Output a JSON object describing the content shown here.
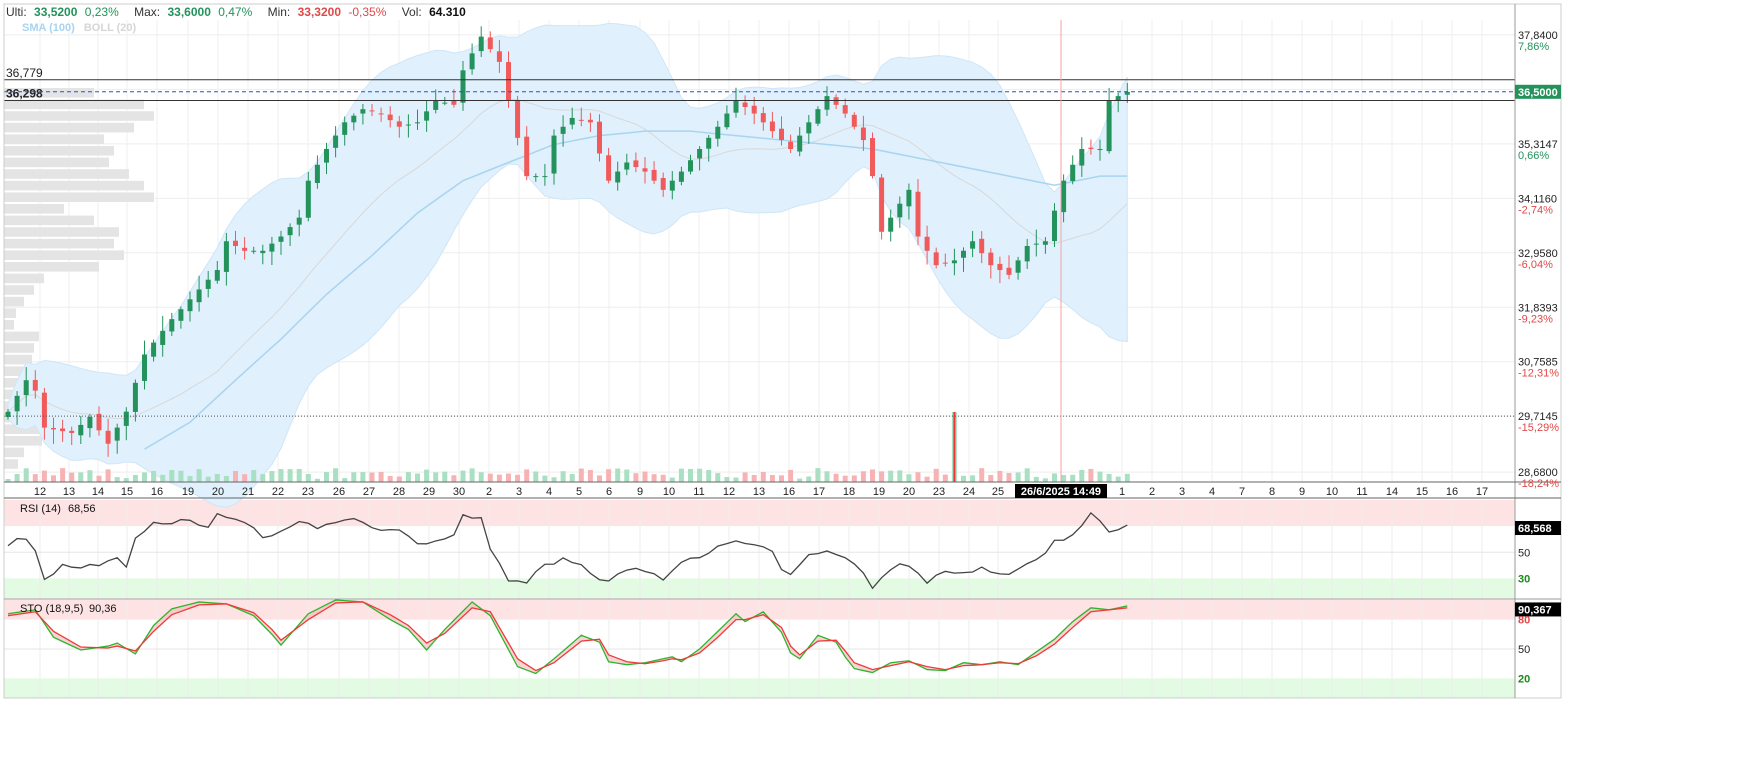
{
  "topbar": {
    "last_label": "Ulti:",
    "last_value": "33,5200",
    "last_pct": "0,23%",
    "max_label": "Max:",
    "max_value": "33,6000",
    "max_pct": "0,47%",
    "min_label": "Min:",
    "min_value": "33,3200",
    "min_pct": "-0,35%",
    "vol_label": "Vol:",
    "vol_value": "64.310"
  },
  "legend": {
    "sma": "SMA (100)",
    "boll": "BOLL (20)"
  },
  "colors": {
    "up": "#23925b",
    "down": "#f05a5a",
    "sma": "#a8d4f0",
    "band_fill": "#e0f0fc",
    "rsi": "#444444",
    "sto_k": "#2db52d",
    "sto_d": "#ee3a3a",
    "overbought": "#fde3e3",
    "oversold": "#e3fae3",
    "price_tag": "#23925b"
  },
  "chart_data": [
    {
      "type": "candlestick",
      "ticker_panel": "price",
      "y_ticks": [
        {
          "value": "37,8400",
          "pct": "7,86%"
        },
        {
          "value": "36,5555",
          "pct": ""
        },
        {
          "value": "35,3147",
          "pct": "0,66%"
        },
        {
          "value": "34,1160",
          "pct": "-2,74%"
        },
        {
          "value": "32,9580",
          "pct": "-6,04%"
        },
        {
          "value": "31,8393",
          "pct": "-9,23%"
        },
        {
          "value": "30,7585",
          "pct": "-12,31%"
        },
        {
          "value": "29,7145",
          "pct": "-15,29%"
        },
        {
          "value": "28,6800",
          "pct": "-18,24%"
        }
      ],
      "ylim": [
        28.5,
        38.2
      ],
      "scale": "log",
      "x_ticks": [
        "12",
        "13",
        "14",
        "15",
        "16",
        "19",
        "20",
        "21",
        "22",
        "23",
        "26",
        "27",
        "28",
        "29",
        "30",
        "2",
        "3",
        "4",
        "5",
        "6",
        "9",
        "10",
        "11",
        "12",
        "13",
        "16",
        "17",
        "18",
        "19",
        "20",
        "23",
        "24",
        "25",
        "1",
        "2",
        "3",
        "4",
        "7",
        "8",
        "9",
        "10",
        "11",
        "14",
        "15",
        "16",
        "17"
      ],
      "crosshair_label": "26/6/2025 14:49",
      "current_price_tag": "36,5000",
      "current_price": 36.5,
      "level_lines": [
        {
          "label": "36,779",
          "value": 36.779
        },
        {
          "label": "36,298",
          "value": 36.298
        }
      ],
      "reference_line": 29.7145,
      "anchors": [
        [
          0,
          29.8
        ],
        [
          2,
          30.4
        ],
        [
          3,
          30.2
        ],
        [
          4,
          29.5
        ],
        [
          7,
          29.4
        ],
        [
          9,
          29.7
        ],
        [
          11,
          29.2
        ],
        [
          13,
          29.8
        ],
        [
          15,
          30.9
        ],
        [
          18,
          31.6
        ],
        [
          21,
          32.2
        ],
        [
          23,
          32.6
        ],
        [
          24,
          33.2
        ],
        [
          26,
          33.0
        ],
        [
          28,
          33.0
        ],
        [
          30,
          33.3
        ],
        [
          32,
          33.7
        ],
        [
          33,
          34.5
        ],
        [
          35,
          35.2
        ],
        [
          37,
          35.8
        ],
        [
          39,
          36.1
        ],
        [
          41,
          36.0
        ],
        [
          43,
          35.7
        ],
        [
          45,
          35.8
        ],
        [
          47,
          36.3
        ],
        [
          49,
          36.2
        ],
        [
          50,
          37.0
        ],
        [
          52,
          37.8
        ],
        [
          54,
          37.2
        ],
        [
          55,
          36.3
        ],
        [
          57,
          34.6
        ],
        [
          59,
          34.6
        ],
        [
          60,
          35.5
        ],
        [
          62,
          35.9
        ],
        [
          64,
          35.8
        ],
        [
          65,
          35.1
        ],
        [
          66,
          34.5
        ],
        [
          68,
          34.9
        ],
        [
          70,
          34.7
        ],
        [
          72,
          34.3
        ],
        [
          74,
          34.7
        ],
        [
          76,
          35.2
        ],
        [
          78,
          35.7
        ],
        [
          80,
          36.3
        ],
        [
          82,
          36.0
        ],
        [
          84,
          35.6
        ],
        [
          86,
          35.2
        ],
        [
          88,
          35.8
        ],
        [
          90,
          36.4
        ],
        [
          92,
          36.0
        ],
        [
          94,
          35.4
        ],
        [
          95,
          34.6
        ],
        [
          96,
          33.4
        ],
        [
          98,
          34.0
        ],
        [
          99,
          34.3
        ],
        [
          100,
          33.3
        ],
        [
          102,
          32.7
        ],
        [
          104,
          32.8
        ],
        [
          106,
          33.2
        ],
        [
          108,
          32.7
        ],
        [
          110,
          32.5
        ],
        [
          112,
          33.1
        ],
        [
          114,
          33.2
        ],
        [
          116,
          34.5
        ],
        [
          118,
          35.2
        ],
        [
          120,
          35.2
        ],
        [
          121,
          36.3
        ],
        [
          123,
          36.5
        ]
      ],
      "sma_anchors": [
        [
          15,
          29.1
        ],
        [
          20,
          29.6
        ],
        [
          25,
          30.4
        ],
        [
          30,
          31.2
        ],
        [
          35,
          32.1
        ],
        [
          40,
          32.9
        ],
        [
          45,
          33.8
        ],
        [
          50,
          34.5
        ],
        [
          55,
          34.9
        ],
        [
          60,
          35.3
        ],
        [
          65,
          35.5
        ],
        [
          70,
          35.6
        ],
        [
          75,
          35.6
        ],
        [
          80,
          35.5
        ],
        [
          85,
          35.4
        ],
        [
          90,
          35.3
        ],
        [
          95,
          35.2
        ],
        [
          100,
          35.0
        ],
        [
          105,
          34.8
        ],
        [
          110,
          34.6
        ],
        [
          115,
          34.4
        ],
        [
          120,
          34.6
        ],
        [
          123,
          34.6
        ]
      ]
    },
    {
      "type": "line",
      "ticker_panel": "rsi",
      "label": "RSI (14)",
      "last_label": "68,56",
      "tag": "68,568",
      "levels": [
        "50",
        "30"
      ],
      "ylim": [
        15,
        90
      ],
      "anchors": [
        [
          0,
          57
        ],
        [
          2,
          60
        ],
        [
          3,
          50
        ],
        [
          4,
          28
        ],
        [
          6,
          42
        ],
        [
          8,
          38
        ],
        [
          10,
          40
        ],
        [
          12,
          44
        ],
        [
          13,
          38
        ],
        [
          14,
          60
        ],
        [
          16,
          71
        ],
        [
          20,
          74
        ],
        [
          22,
          69
        ],
        [
          23,
          78
        ],
        [
          25,
          76
        ],
        [
          27,
          69
        ],
        [
          28,
          60
        ],
        [
          30,
          66
        ],
        [
          32,
          72
        ],
        [
          34,
          70
        ],
        [
          36,
          73
        ],
        [
          38,
          74
        ],
        [
          40,
          69
        ],
        [
          42,
          68
        ],
        [
          44,
          63
        ],
        [
          45,
          57
        ],
        [
          47,
          57
        ],
        [
          49,
          65
        ],
        [
          50,
          78
        ],
        [
          52,
          77
        ],
        [
          53,
          53
        ],
        [
          55,
          28
        ],
        [
          57,
          26
        ],
        [
          59,
          41
        ],
        [
          61,
          44
        ],
        [
          63,
          40
        ],
        [
          65,
          30
        ],
        [
          66,
          28
        ],
        [
          68,
          38
        ],
        [
          70,
          36
        ],
        [
          72,
          30
        ],
        [
          74,
          42
        ],
        [
          76,
          45
        ],
        [
          78,
          56
        ],
        [
          80,
          59
        ],
        [
          82,
          54
        ],
        [
          84,
          52
        ],
        [
          85,
          38
        ],
        [
          86,
          33
        ],
        [
          88,
          47
        ],
        [
          90,
          49
        ],
        [
          92,
          46
        ],
        [
          94,
          36
        ],
        [
          95,
          24
        ],
        [
          97,
          38
        ],
        [
          99,
          41
        ],
        [
          101,
          28
        ],
        [
          103,
          35
        ],
        [
          105,
          33
        ],
        [
          107,
          37
        ],
        [
          109,
          32
        ],
        [
          111,
          38
        ],
        [
          113,
          43
        ],
        [
          115,
          58
        ],
        [
          117,
          62
        ],
        [
          119,
          79
        ],
        [
          121,
          67
        ],
        [
          123,
          69
        ]
      ]
    },
    {
      "type": "line",
      "ticker_panel": "sto",
      "label": "STO (18,9,5)",
      "last_label": "90,36",
      "tag": "90,367",
      "levels": [
        "80",
        "50",
        "20"
      ],
      "ylim": [
        0,
        100
      ],
      "k_anchors": [
        [
          0,
          86
        ],
        [
          3,
          90
        ],
        [
          5,
          62
        ],
        [
          8,
          49
        ],
        [
          11,
          53
        ],
        [
          12,
          56
        ],
        [
          14,
          45
        ],
        [
          16,
          74
        ],
        [
          18,
          91
        ],
        [
          21,
          98
        ],
        [
          24,
          96
        ],
        [
          27,
          84
        ],
        [
          29,
          65
        ],
        [
          30,
          54
        ],
        [
          33,
          86
        ],
        [
          36,
          100
        ],
        [
          39,
          98
        ],
        [
          42,
          80
        ],
        [
          44,
          70
        ],
        [
          46,
          49
        ],
        [
          48,
          70
        ],
        [
          51,
          98
        ],
        [
          53,
          84
        ],
        [
          56,
          32
        ],
        [
          58,
          25
        ],
        [
          60,
          40
        ],
        [
          63,
          64
        ],
        [
          65,
          57
        ],
        [
          66,
          37
        ],
        [
          68,
          34
        ],
        [
          70,
          36
        ],
        [
          72,
          40
        ],
        [
          73,
          42
        ],
        [
          74,
          37
        ],
        [
          76,
          50
        ],
        [
          78,
          68
        ],
        [
          80,
          86
        ],
        [
          81,
          78
        ],
        [
          83,
          88
        ],
        [
          85,
          67
        ],
        [
          86,
          46
        ],
        [
          87,
          40
        ],
        [
          89,
          64
        ],
        [
          91,
          57
        ],
        [
          92,
          42
        ],
        [
          93,
          30
        ],
        [
          95,
          26
        ],
        [
          97,
          36
        ],
        [
          99,
          38
        ],
        [
          101,
          29
        ],
        [
          103,
          28
        ],
        [
          105,
          36
        ],
        [
          107,
          34
        ],
        [
          109,
          37
        ],
        [
          111,
          34
        ],
        [
          113,
          47
        ],
        [
          115,
          60
        ],
        [
          117,
          78
        ],
        [
          119,
          92
        ],
        [
          121,
          90
        ],
        [
          123,
          94
        ]
      ],
      "d_anchors": [
        [
          0,
          84
        ],
        [
          3,
          88
        ],
        [
          5,
          68
        ],
        [
          8,
          52
        ],
        [
          11,
          51
        ],
        [
          12,
          53
        ],
        [
          14,
          48
        ],
        [
          16,
          68
        ],
        [
          18,
          85
        ],
        [
          21,
          95
        ],
        [
          24,
          96
        ],
        [
          27,
          87
        ],
        [
          29,
          70
        ],
        [
          30,
          59
        ],
        [
          33,
          80
        ],
        [
          36,
          97
        ],
        [
          39,
          98
        ],
        [
          42,
          85
        ],
        [
          44,
          74
        ],
        [
          46,
          56
        ],
        [
          48,
          66
        ],
        [
          51,
          92
        ],
        [
          53,
          88
        ],
        [
          56,
          40
        ],
        [
          58,
          28
        ],
        [
          60,
          36
        ],
        [
          63,
          58
        ],
        [
          65,
          60
        ],
        [
          66,
          44
        ],
        [
          68,
          37
        ],
        [
          70,
          35
        ],
        [
          72,
          38
        ],
        [
          73,
          40
        ],
        [
          74,
          39
        ],
        [
          76,
          46
        ],
        [
          78,
          62
        ],
        [
          80,
          80
        ],
        [
          81,
          80
        ],
        [
          83,
          85
        ],
        [
          85,
          72
        ],
        [
          86,
          53
        ],
        [
          87,
          44
        ],
        [
          89,
          58
        ],
        [
          91,
          59
        ],
        [
          92,
          48
        ],
        [
          93,
          36
        ],
        [
          95,
          29
        ],
        [
          97,
          33
        ],
        [
          99,
          37
        ],
        [
          101,
          32
        ],
        [
          103,
          29
        ],
        [
          105,
          33
        ],
        [
          107,
          34
        ],
        [
          109,
          36
        ],
        [
          111,
          35
        ],
        [
          113,
          43
        ],
        [
          115,
          55
        ],
        [
          117,
          72
        ],
        [
          119,
          88
        ],
        [
          121,
          90
        ],
        [
          123,
          92
        ]
      ]
    }
  ]
}
